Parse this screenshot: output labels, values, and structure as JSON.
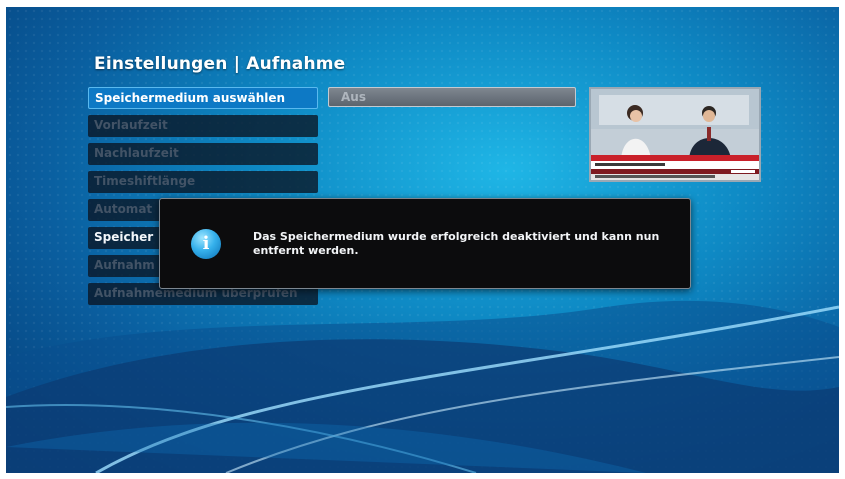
{
  "header": {
    "title": "Einstellungen | Aufnahme"
  },
  "menu": {
    "items": [
      {
        "label": "Speichermedium auswählen"
      },
      {
        "label": "Vorlaufzeit"
      },
      {
        "label": "Nachlaufzeit"
      },
      {
        "label": "Timeshiftlänge"
      },
      {
        "label": "Automat"
      },
      {
        "label": "Speicher"
      },
      {
        "label": "Aufnahm"
      },
      {
        "label": "Aufnahmemedium überprüfen"
      }
    ]
  },
  "value": {
    "label": "Aus"
  },
  "dialog": {
    "icon": "info-icon",
    "message": "Das Speichermedium wurde erfolgreich deaktiviert und kann nun entfernt werden."
  },
  "colors": {
    "accent": "#0d79c5",
    "background_top": "#1fb6e6",
    "background_bottom": "#053b74",
    "dialog_bg": "#0c0c0d"
  }
}
